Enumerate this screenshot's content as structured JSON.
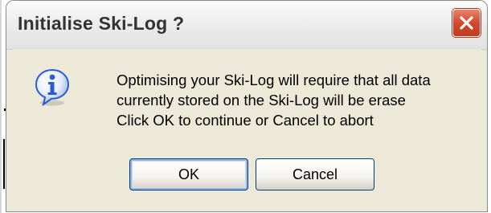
{
  "window": {
    "title": "Initialise Ski-Log ?"
  },
  "icons": {
    "message_icon": "information-icon",
    "close_icon": "close-icon"
  },
  "message": {
    "lines": [
      "Optimising your Ski-Log will require that all data",
      "currently stored on the Ski-Log will be erase",
      "Click OK to continue or Cancel to abort"
    ]
  },
  "buttons": {
    "ok_label": "OK",
    "cancel_label": "Cancel"
  },
  "colors": {
    "close_button": "#d2492c",
    "dialog_background": "#ece9d8",
    "button_border": "#003c74",
    "info_icon": "#2a5bd0"
  }
}
